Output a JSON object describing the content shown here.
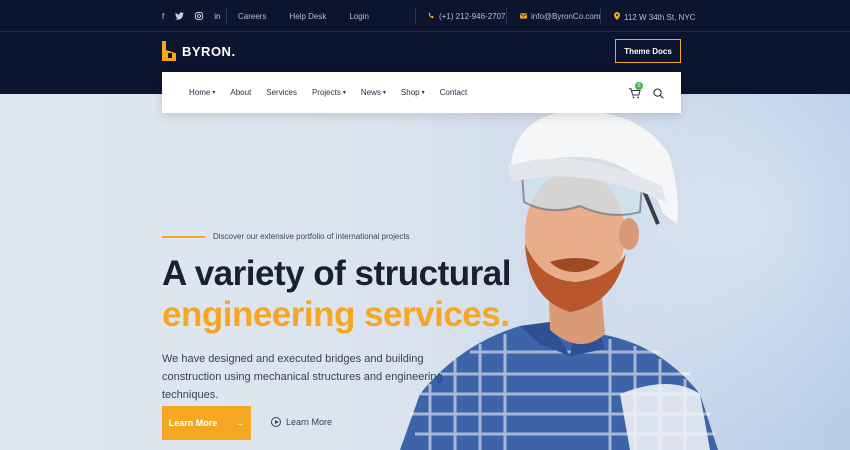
{
  "topbar": {
    "social": [
      {
        "icon": "facebook-icon",
        "glyph": "f"
      },
      {
        "icon": "twitter-icon",
        "glyph": "t"
      },
      {
        "icon": "instagram-icon",
        "glyph": "◎"
      },
      {
        "icon": "linkedin-icon",
        "glyph": "in"
      }
    ],
    "links": [
      "Careers",
      "Help Desk",
      "Login"
    ],
    "phone": "(+1) 212-946-2707",
    "email": "info@ByronCo.com",
    "address": "112 W 34th St, NYC"
  },
  "header": {
    "logo_text": "BYRON.",
    "theme_docs_label": "Theme Docs"
  },
  "nav": {
    "items": [
      {
        "label": "Home",
        "dropdown": true
      },
      {
        "label": "About",
        "dropdown": false
      },
      {
        "label": "Services",
        "dropdown": false
      },
      {
        "label": "Projects",
        "dropdown": true
      },
      {
        "label": "News",
        "dropdown": true
      },
      {
        "label": "Shop",
        "dropdown": true
      },
      {
        "label": "Contact",
        "dropdown": false
      }
    ],
    "cart_count": "0"
  },
  "hero": {
    "tagline": "Discover our extensive portfolio of international projects",
    "heading_line1": "A variety of structural",
    "heading_line2": "engineering services.",
    "description": "We have designed and executed bridges and building construction using mechanical structures and engineering techniques.",
    "primary_button": "Learn More",
    "secondary_button": "Learn More"
  },
  "colors": {
    "accent": "#f5a623",
    "navy": "#0b1530",
    "badge": "#3cba54"
  }
}
